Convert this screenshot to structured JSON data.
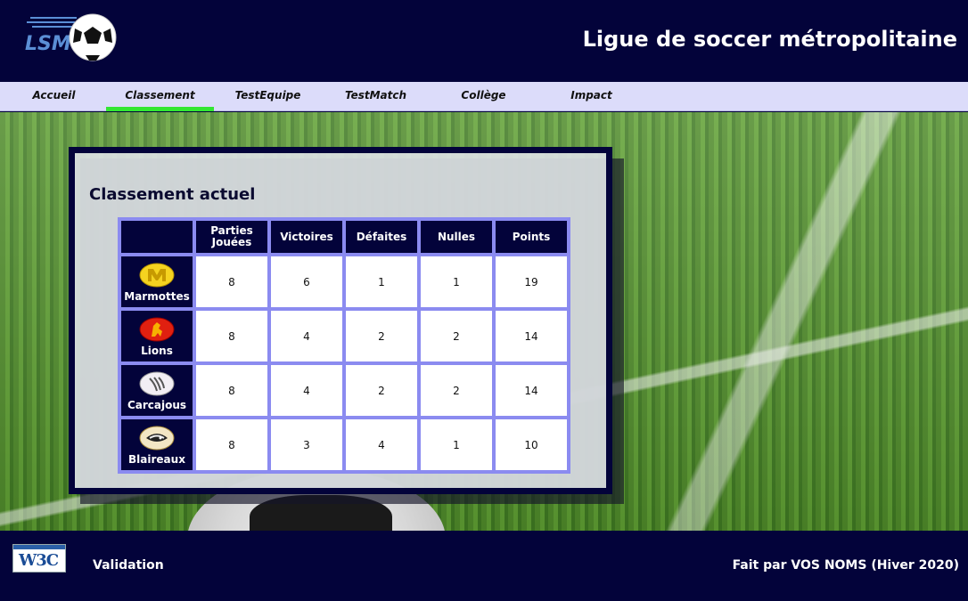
{
  "header": {
    "logo_text": "LSM",
    "site_title": "Ligue de soccer métropolitaine"
  },
  "nav": {
    "items": [
      {
        "label": "Accueil"
      },
      {
        "label": "Classement"
      },
      {
        "label": "TestEquipe"
      },
      {
        "label": "TestMatch"
      },
      {
        "label": "Collège"
      },
      {
        "label": "Impact"
      }
    ],
    "active_index": 1,
    "active_color": "#33e733"
  },
  "panel": {
    "title": "Classement actuel",
    "columns": [
      "Parties Jouées",
      "Victoires",
      "Défaites",
      "Nulles",
      "Points"
    ],
    "rows": [
      {
        "team": "Marmottes",
        "logo": "marmottes-logo",
        "played": "8",
        "wins": "6",
        "losses": "1",
        "draws": "1",
        "points": "19"
      },
      {
        "team": "Lions",
        "logo": "lions-logo",
        "played": "8",
        "wins": "4",
        "losses": "2",
        "draws": "2",
        "points": "14"
      },
      {
        "team": "Carcajous",
        "logo": "carcajous-logo",
        "played": "8",
        "wins": "4",
        "losses": "2",
        "draws": "2",
        "points": "14"
      },
      {
        "team": "Blaireaux",
        "logo": "blaireaux-logo",
        "played": "8",
        "wins": "3",
        "losses": "4",
        "draws": "1",
        "points": "10"
      }
    ]
  },
  "footer": {
    "badge_text": "W3C",
    "validation_label": "Validation",
    "credits": "Fait par VOS NOMS (Hiver 2020)"
  },
  "colors": {
    "navy": "#03033a",
    "table_border": "#8b8bf0",
    "nav_bg": "#dcdcfa"
  }
}
